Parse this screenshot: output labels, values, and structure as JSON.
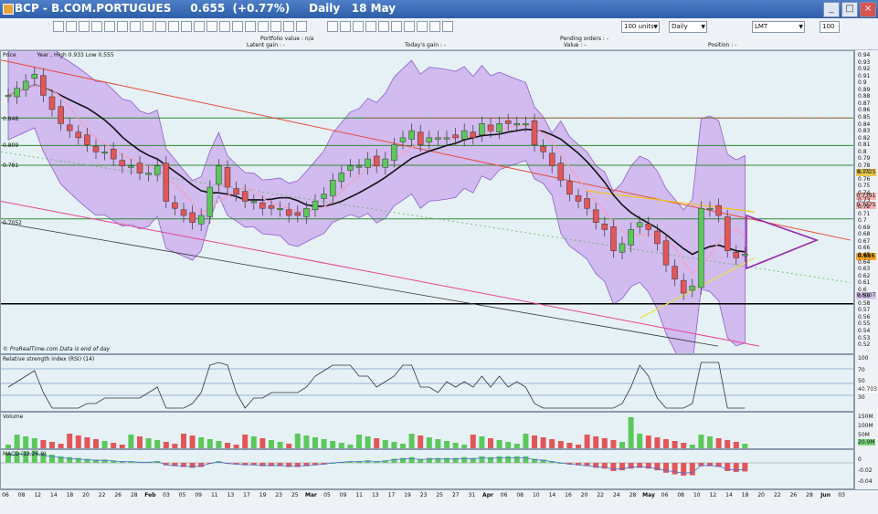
{
  "window": {
    "title": "BCP - B.COM.PORTUGUES     0.655  (+0.77%)     Daily   18 May",
    "buttons": [
      "_",
      "□",
      "×"
    ]
  },
  "toolbar": {
    "icons": [
      "undo-icon",
      "redo-icon",
      "zoom-icon",
      "crosshair-icon",
      "line-tool-icon",
      "trend-icon",
      "fib-icon",
      "text-icon",
      "arrow-up-icon",
      "arrow-down-icon",
      "delete-icon",
      "settings-icon",
      "print-icon",
      "copy-icon",
      "save-icon",
      "layout-icon",
      "indicator-icon",
      "template-icon",
      "grid-icon",
      "hide-icon",
      "help-icon",
      "info-icon",
      "bell-icon",
      "flag-icon",
      "list-icon",
      "chart-icon",
      "calc-icon",
      "window-icon",
      "order-icon",
      "export-icon"
    ],
    "units_select": "100 units",
    "period_select": "Daily",
    "order_type_select": "LMT",
    "qty_value": "100"
  },
  "infobar": {
    "portfolio": "Portfolio value : n/a",
    "latent": "Latent gain : -",
    "today": "Today's gain : -",
    "pending": "Pending orders : -",
    "value": "Value : -",
    "position": "Position : -"
  },
  "price_panel": {
    "label": "Price",
    "legend": "Year , High 0.933 Low 0.555",
    "footer": "© ProRealTime.com  Data is end of day",
    "line_labels": [
      "0.848",
      "0.809",
      "0.781",
      "0.7052"
    ],
    "right_tags": [
      "0.7725",
      "0.7391",
      "0.7275",
      "0.655",
      "0.6007"
    ],
    "axis": [
      "0.94",
      "0.93",
      "0.92",
      "0.91",
      "0.9",
      "0.89",
      "0.88",
      "0.87",
      "0.86",
      "0.85",
      "0.84",
      "0.83",
      "0.82",
      "0.81",
      "0.8",
      "0.79",
      "0.78",
      "0.77",
      "0.76",
      "0.75",
      "0.74",
      "0.73",
      "0.72",
      "0.71",
      "0.7",
      "0.69",
      "0.68",
      "0.67",
      "0.66",
      "0.65",
      "0.64",
      "0.63",
      "0.62",
      "0.61",
      "0.6",
      "0.59",
      "0.58",
      "0.57",
      "0.56",
      "0.55",
      "0.54",
      "0.53",
      "0.52"
    ]
  },
  "rsi_panel": {
    "label": "Relative strength index (RSI) (14)",
    "axis": [
      "100",
      "70",
      "50",
      "40.703",
      "30"
    ]
  },
  "volume_panel": {
    "label": "Volume",
    "axis": [
      "150M",
      "100M",
      "50M",
      "20.9M"
    ]
  },
  "macd_panel": {
    "label": "MACD (12,26,9)",
    "axis": [
      "0",
      "-0.02",
      "-0.04"
    ]
  },
  "xaxis": {
    "dates": [
      "06",
      "08",
      "12",
      "14",
      "18",
      "20",
      "22",
      "26",
      "28",
      "Feb",
      "03",
      "05",
      "09",
      "11",
      "13",
      "17",
      "19",
      "23",
      "25",
      "Mar",
      "05",
      "09",
      "11",
      "13",
      "17",
      "19",
      "23",
      "25",
      "27",
      "31",
      "Apr",
      "06",
      "08",
      "10",
      "14",
      "16",
      "20",
      "22",
      "24",
      "28",
      "May",
      "06",
      "08",
      "10",
      "12",
      "14",
      "18",
      "20",
      "22",
      "26",
      "28",
      "Jun",
      "03"
    ]
  },
  "chart_data": {
    "type": "candlestick",
    "last": 0.655,
    "change": "+0.77%",
    "closes": [
      0.88,
      0.89,
      0.9,
      0.91,
      0.88,
      0.86,
      0.84,
      0.83,
      0.82,
      0.81,
      0.8,
      0.8,
      0.79,
      0.78,
      0.78,
      0.77,
      0.77,
      0.78,
      0.73,
      0.72,
      0.71,
      0.7,
      0.71,
      0.75,
      0.78,
      0.75,
      0.74,
      0.73,
      0.73,
      0.72,
      0.72,
      0.72,
      0.71,
      0.71,
      0.72,
      0.73,
      0.74,
      0.76,
      0.77,
      0.78,
      0.78,
      0.79,
      0.78,
      0.79,
      0.81,
      0.82,
      0.83,
      0.81,
      0.82,
      0.82,
      0.82,
      0.82,
      0.83,
      0.82,
      0.84,
      0.83,
      0.84,
      0.84,
      0.84,
      0.84,
      0.81,
      0.8,
      0.78,
      0.76,
      0.74,
      0.73,
      0.72,
      0.7,
      0.69,
      0.66,
      0.67,
      0.69,
      0.7,
      0.69,
      0.67,
      0.64,
      0.62,
      0.6,
      0.61,
      0.72,
      0.72,
      0.71,
      0.66,
      0.65,
      0.655
    ]
  }
}
